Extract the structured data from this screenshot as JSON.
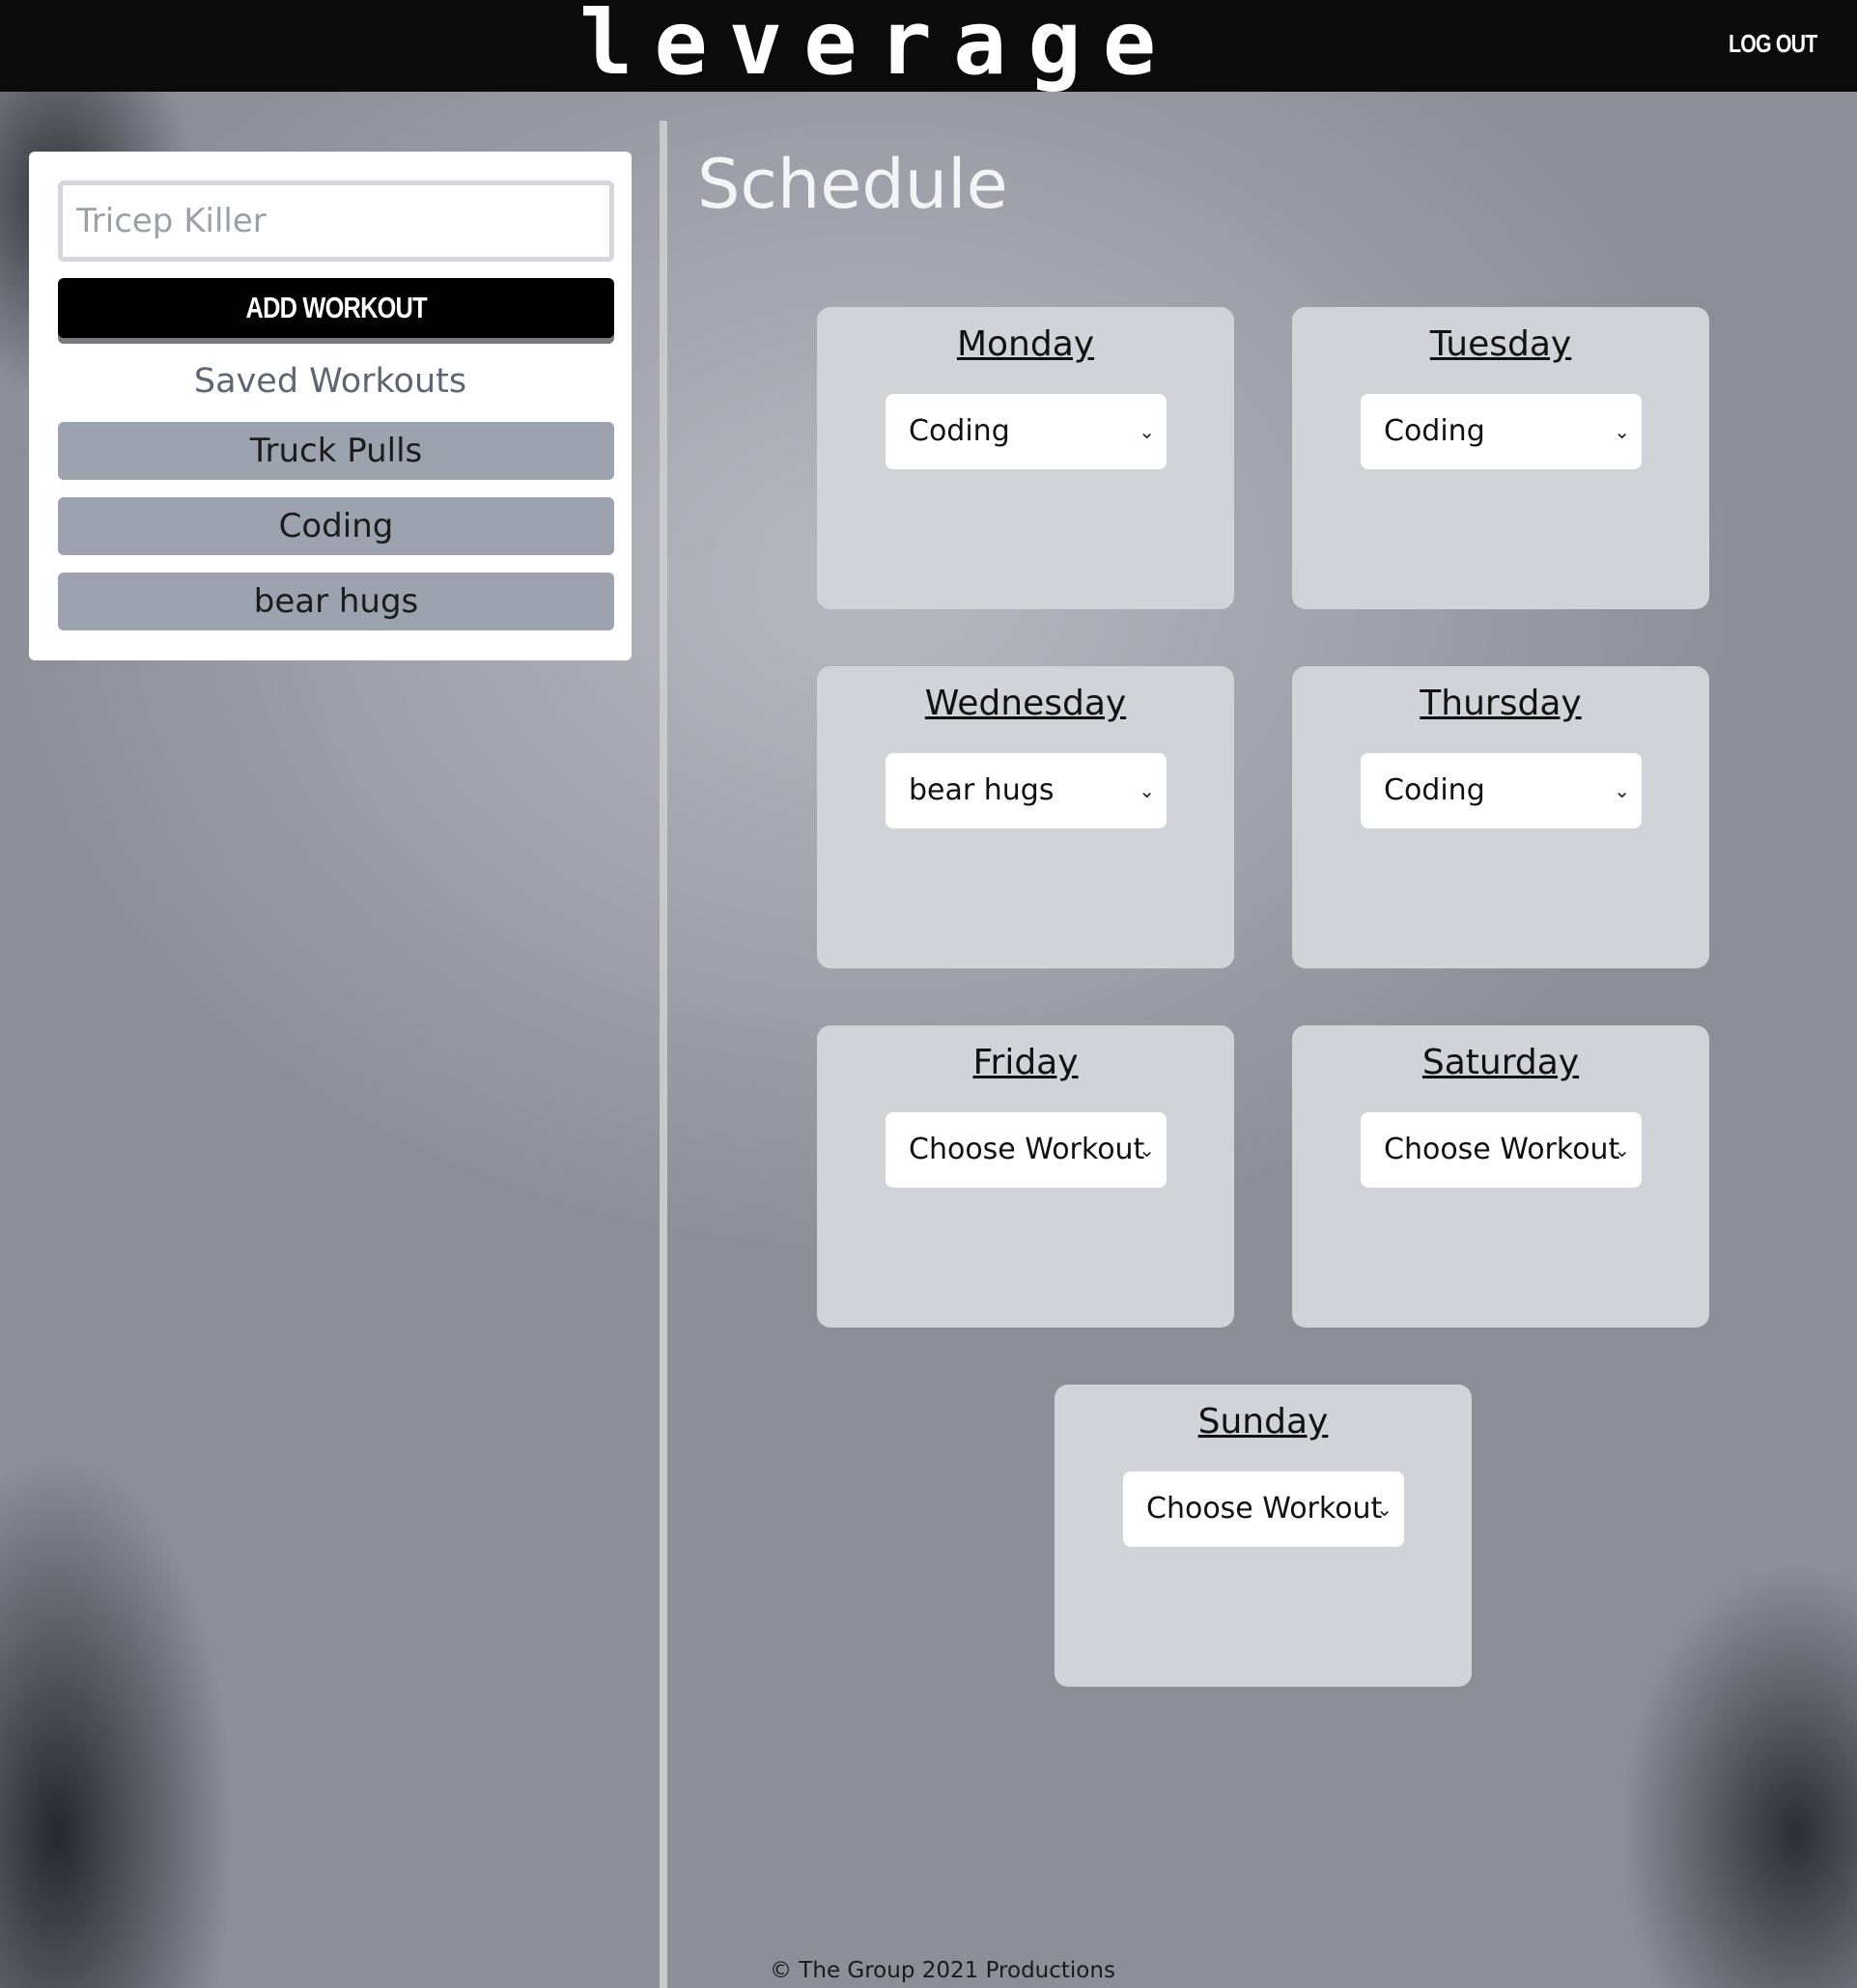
{
  "header": {
    "brand": "leverage",
    "logout_label": "LOG OUT"
  },
  "sidebar": {
    "input_placeholder": "Tricep Killer",
    "add_button_label": "ADD WORKOUT",
    "saved_title": "Saved Workouts",
    "saved_workouts": [
      "Truck Pulls",
      "Coding",
      "bear hugs"
    ]
  },
  "schedule": {
    "title": "Schedule",
    "days": [
      {
        "name": "Monday",
        "selected": "Coding"
      },
      {
        "name": "Tuesday",
        "selected": "Coding"
      },
      {
        "name": "Wednesday",
        "selected": "bear hugs"
      },
      {
        "name": "Thursday",
        "selected": "Coding"
      },
      {
        "name": "Friday",
        "selected": "Choose Workout"
      },
      {
        "name": "Saturday",
        "selected": "Choose Workout"
      },
      {
        "name": "Sunday",
        "selected": "Choose Workout"
      }
    ]
  },
  "footer": {
    "text": "© The Group 2021 Productions"
  },
  "icons": {
    "dropdown": "chevron-down-icon"
  }
}
